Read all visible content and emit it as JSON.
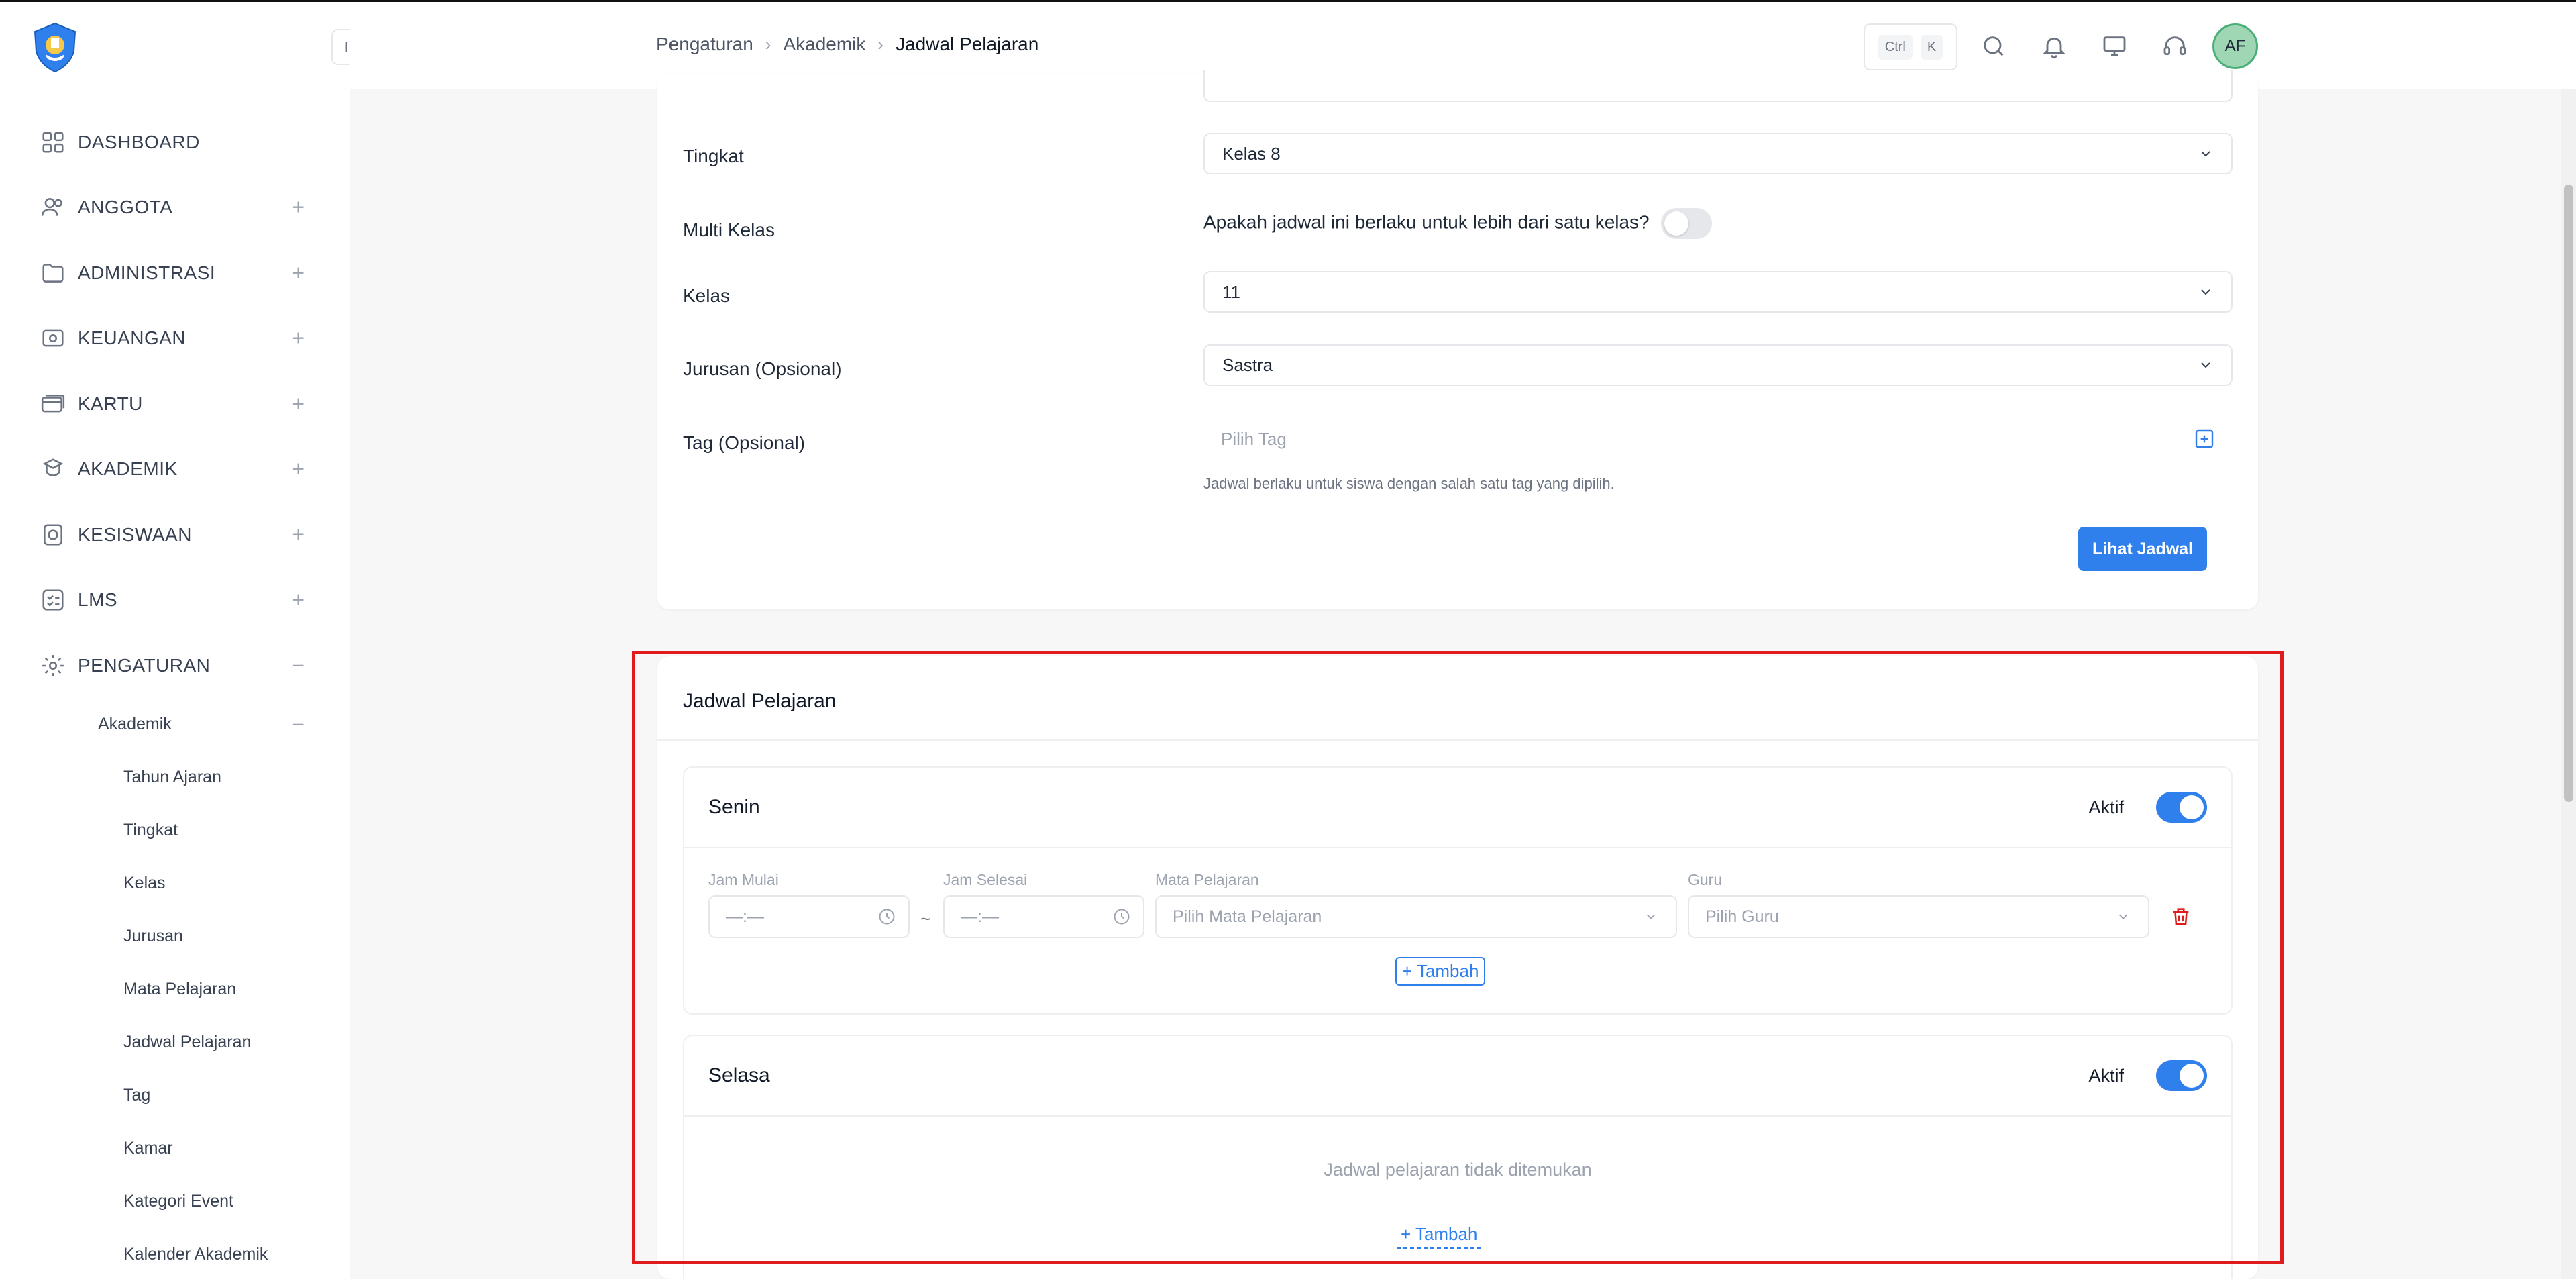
{
  "breadcrumb": [
    "Pengaturan",
    "Akademik",
    "Jadwal Pelajaran"
  ],
  "shortcut": {
    "key1": "Ctrl",
    "key2": "K"
  },
  "user": {
    "initials": "AF"
  },
  "sidebar": {
    "items": [
      {
        "label": "DASHBOARD",
        "icon": "dashboard-icon",
        "toggle": ""
      },
      {
        "label": "ANGGOTA",
        "icon": "users-icon",
        "toggle": "+"
      },
      {
        "label": "ADMINISTRASI",
        "icon": "folder-icon",
        "toggle": "+"
      },
      {
        "label": "KEUANGAN",
        "icon": "money-icon",
        "toggle": "+"
      },
      {
        "label": "KARTU",
        "icon": "card-icon",
        "toggle": "+"
      },
      {
        "label": "AKADEMIK",
        "icon": "academic-icon",
        "toggle": "+"
      },
      {
        "label": "KESISWAAN",
        "icon": "badge-icon",
        "toggle": "+"
      },
      {
        "label": "LMS",
        "icon": "checklist-icon",
        "toggle": "+"
      },
      {
        "label": "PENGATURAN",
        "icon": "gear-icon",
        "toggle": "−"
      }
    ],
    "submenu": {
      "label": "Akademik",
      "toggle": "−",
      "items": [
        "Tahun Ajaran",
        "Tingkat",
        "Kelas",
        "Jurusan",
        "Mata Pelajaran",
        "Jadwal Pelajaran",
        "Tag",
        "Kamar",
        "Kategori Event",
        "Kalender Akademik"
      ]
    }
  },
  "form": {
    "tingkat_label": "Tingkat",
    "tingkat_value": "Kelas 8",
    "multi_label": "Multi Kelas",
    "multi_question": "Apakah jadwal ini berlaku untuk lebih dari satu kelas?",
    "multi_enabled": false,
    "kelas_label": "Kelas",
    "kelas_value": "11",
    "jurusan_label": "Jurusan (Opsional)",
    "jurusan_value": "Sastra",
    "tag_label": "Tag (Opsional)",
    "tag_placeholder": "Pilih Tag",
    "tag_hint": "Jadwal berlaku untuk siswa dengan salah satu tag yang dipilih.",
    "submit_label": "Lihat Jadwal"
  },
  "schedule": {
    "title": "Jadwal Pelajaran",
    "aktif_label": "Aktif",
    "add_label": "+ Tambah",
    "days": [
      {
        "name": "Senin",
        "active": true,
        "fields": {
          "jam_mulai_label": "Jam Mulai",
          "jam_mulai_value": "—:—",
          "jam_selesai_label": "Jam Selesai",
          "jam_selesai_value": "—:—",
          "separator": "~",
          "mapel_label": "Mata Pelajaran",
          "mapel_placeholder": "Pilih Mata Pelajaran",
          "guru_label": "Guru",
          "guru_placeholder": "Pilih Guru"
        }
      },
      {
        "name": "Selasa",
        "active": true,
        "empty_message": "Jadwal pelajaran tidak ditemukan"
      }
    ]
  },
  "colors": {
    "primary": "#2f80ed",
    "danger": "#e01b1b",
    "highlight": "#e01b1b"
  }
}
